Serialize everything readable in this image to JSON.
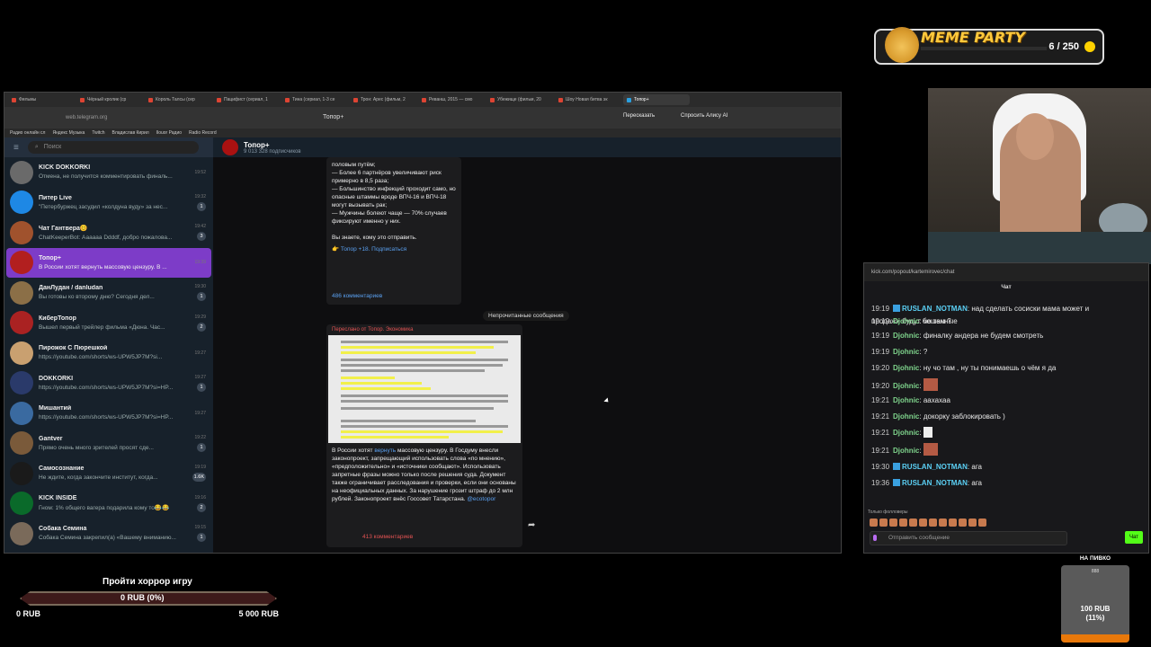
{
  "meme_party": {
    "title": "MEME PARTY",
    "count": "6 / 250"
  },
  "browser": {
    "tabs": [
      "Фильмы",
      "Чёрный кролик (ср",
      "Король Талсы (сер",
      "Пацифист (сериал, 1",
      "Тина (сериал, 1-3 се",
      "Трон: Арес (фильм, 2",
      "Реванш, 2015 — смо",
      "Убежище (фильм, 20",
      "Шоу Новая битва эк",
      "Топор+"
    ],
    "url": "web.telegram.org",
    "page_title": "Топор+",
    "translate": "Пересказать",
    "alice": "Спросить Алису AI",
    "bookmarks": [
      "Радио онлайн сл",
      "Яндекс Музыка",
      "Twitch",
      "Владислав Кирил",
      "Ilouor Радио",
      "Radio Record"
    ]
  },
  "telegram": {
    "search_placeholder": "Поиск",
    "chats": [
      {
        "name": "KICK DOKKORKI",
        "preview": "Отмена, не получится комментировать финаль...",
        "time": "19:52",
        "badge": ""
      },
      {
        "name": "Питер Live",
        "preview": "\"Петербуржец засудил «колдуна вуду» за нес...",
        "time": "19:32",
        "badge": "1"
      },
      {
        "name": "Чат Гантвера😊",
        "preview": "ChatKeeperBot: Аааааа Ddddf, добро пожалова...",
        "time": "19:42",
        "badge": "3"
      },
      {
        "name": "Топор+",
        "preview": "В России хотят вернуть массовую цензуру. В ...",
        "time": "19:39",
        "badge": ""
      },
      {
        "name": "ДанЛудан / danludan",
        "preview": "Вы готовы ко второму дню? Сегодня дел...",
        "time": "19:30",
        "badge": "1"
      },
      {
        "name": "КиберТопор",
        "preview": "Вышел первый трейлер фильма «Дюна. Час...",
        "time": "19:29",
        "badge": "2"
      },
      {
        "name": "Пирожок С Пюрешкой",
        "preview": "https://youtube.com/shorts/ws-UPW5JP7M?si...",
        "time": "19:27",
        "badge": ""
      },
      {
        "name": "DOKKORKI",
        "preview": "https://youtube.com/shorts/ws-UPW5JP7M?si=HP...",
        "time": "19:27",
        "badge": "1"
      },
      {
        "name": "Мишантий",
        "preview": "https://youtube.com/shorts/ws-UPW5JP7M?si=HP...",
        "time": "19:27",
        "badge": ""
      },
      {
        "name": "Gantver",
        "preview": "Прямо очень много зрителей просят сде...",
        "time": "19:22",
        "badge": "1"
      },
      {
        "name": "Самосознание",
        "preview": "Не ждите, когда закончите институт, когда...",
        "time": "19:19",
        "badge": "1.6K"
      },
      {
        "name": "KICK INSIDE",
        "preview": "Гном: 1% общего вагера подарила кому то😂😂",
        "time": "19:16",
        "badge": "2"
      },
      {
        "name": "Собака Семина",
        "preview": "Собака Семина закрепил(а) «Вашему вниманию...",
        "time": "19:15",
        "badge": "1"
      }
    ],
    "channel": {
      "name": "Топор+",
      "subs": "9 013 328 подписчиков"
    },
    "post1": {
      "text": "половым путём;\n— Более 6 партнёров увеличивают риск примерно в 8,5 раза;\n— Большинство инфекций проходит само, но опасные штаммы вроде ВПЧ-16 и ВПЧ-18 могут вызывать рак;\n— Мужчины болеют чаще — 70% случаев фиксируют именно у них.\n\nВы знаете, кому это отправить.",
      "subscribe": "👉 Топор +18. Подписаться",
      "comments": "486 комментариев"
    },
    "unread": "Непрочитанные сообщения",
    "post2": {
      "forwarded": "Переслано от  Топор. Экономика",
      "text_a": "В России хотят ",
      "link": "вернуть",
      "text_b": " массовую цензуру. В Госдуму внесли законопроект, запрещающий использовать слова «по мнению», «предположительно» и «источники сообщают». Использовать запретные фразы можно только после решения суда. Документ также ограничивает расследования и проверки, если они основаны на неофициальных данных. За нарушение грозит штраф до 2 млн рублей. Законопроект внёс Госсовет Татарстана.",
      "tag": " @ecotopor",
      "comments": "413 комментариев"
    }
  },
  "kick": {
    "url": "kick.com/popout/kartemirovec/chat",
    "header": "Чат",
    "messages": [
      {
        "time": "19:19",
        "user": "RUSLAN_NOTMAN",
        "text": ": над сделать сосиски мама может и",
        "cont": "продажи будут бешенные",
        "kind": "u1"
      },
      {
        "time": "19:19",
        "user": "Djohnic",
        "text": ": чо там ?",
        "kind": "u2"
      },
      {
        "time": "19:19",
        "user": "Djohnic",
        "text": ": финалку андера не будем смотреть",
        "kind": "u2"
      },
      {
        "time": "19:19",
        "user": "Djohnic",
        "text": ": ?",
        "kind": "u2"
      },
      {
        "time": "19:20",
        "user": "Djohnic",
        "text": ": ну чо там , ну ты понимаешь о чём я да",
        "kind": "u2"
      },
      {
        "time": "19:20",
        "user": "Djohnic",
        "text": ":",
        "kind": "u2"
      },
      {
        "time": "19:21",
        "user": "Djohnic",
        "text": ": аахахаа",
        "kind": "u2"
      },
      {
        "time": "19:21",
        "user": "Djohnic",
        "text": ": докорку заблокировать )",
        "kind": "u2"
      },
      {
        "time": "19:21",
        "user": "Djohnic",
        "text": ":",
        "kind": "u2"
      },
      {
        "time": "19:21",
        "user": "Djohnic",
        "text": ":",
        "kind": "u2"
      },
      {
        "time": "19:30",
        "user": "RUSLAN_NOTMAN",
        "text": ": ага",
        "kind": "u1"
      },
      {
        "time": "19:36",
        "user": "RUSLAN_NOTMAN",
        "text": ": ага",
        "kind": "u1"
      }
    ],
    "followers_only": "Только фолловеры",
    "input_placeholder": "Отправить сообщение",
    "send": "Чат"
  },
  "goal": {
    "title": "Пройти хоррор игру",
    "value": "0 RUB (0%)",
    "min": "0 RUB",
    "max": "5 000 RUB"
  },
  "beer": {
    "title": "НА ПИВКО",
    "num": "888",
    "value": "100 RUB",
    "pct": "(11%)",
    "progress": 0.11
  }
}
